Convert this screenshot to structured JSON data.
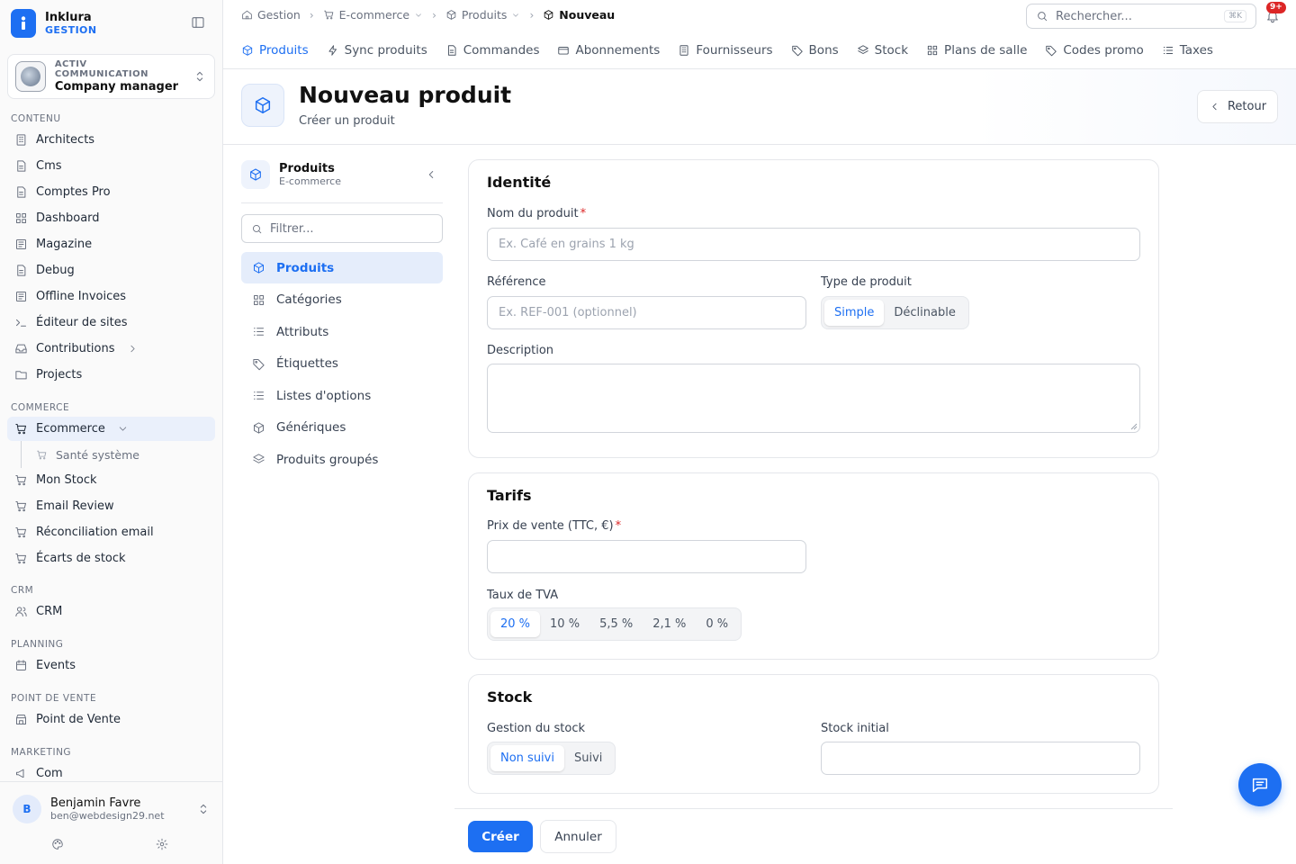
{
  "brand": {
    "name": "Inklura",
    "sub": "GESTION"
  },
  "company": {
    "top": "ACTIV COMMUNICATION",
    "name": "Company manager"
  },
  "sidebar": {
    "sections": [
      {
        "title": "CONTENU",
        "items": [
          "Architects",
          "Cms",
          "Comptes Pro",
          "Dashboard",
          "Magazine",
          "Debug",
          "Offline Invoices",
          "Éditeur de sites",
          "Contributions",
          "Projects"
        ]
      },
      {
        "title": "COMMERCE",
        "items": [
          "Ecommerce",
          "Santé système",
          "Mon Stock",
          "Email Review",
          "Réconciliation email",
          "Écarts de stock"
        ]
      },
      {
        "title": "CRM",
        "items": [
          "CRM"
        ]
      },
      {
        "title": "PLANNING",
        "items": [
          "Events"
        ]
      },
      {
        "title": "POINT DE VENTE",
        "items": [
          "Point de Vente"
        ]
      },
      {
        "title": "MARKETING",
        "items": [
          "Com"
        ]
      }
    ]
  },
  "user": {
    "initial": "B",
    "name": "Benjamin Favre",
    "email": "ben@webdesign29.net"
  },
  "breadcrumb": [
    "Gestion",
    "E-commerce",
    "Produits",
    "Nouveau"
  ],
  "search": {
    "placeholder": "Rechercher...",
    "shortcut": "⌘K"
  },
  "notifications": {
    "badge": "9+"
  },
  "tabs": [
    "Produits",
    "Sync produits",
    "Commandes",
    "Abonnements",
    "Fournisseurs",
    "Bons",
    "Stock",
    "Plans de salle",
    "Codes promo",
    "Taxes"
  ],
  "header": {
    "title": "Nouveau produit",
    "subtitle": "Créer un produit",
    "back": "Retour"
  },
  "subnav": {
    "title": "Produits",
    "subtitle": "E-commerce",
    "filter_placeholder": "Filtrer...",
    "items": [
      "Produits",
      "Catégories",
      "Attributs",
      "Étiquettes",
      "Listes d'options",
      "Génériques",
      "Produits groupés"
    ]
  },
  "identity": {
    "title": "Identité",
    "name_label": "Nom du produit",
    "name_placeholder": "Ex. Café en grains 1 kg",
    "ref_label": "Référence",
    "ref_placeholder": "Ex. REF-001 (optionnel)",
    "type_label": "Type de produit",
    "type_options": [
      "Simple",
      "Déclinable"
    ],
    "type_selected": "Simple",
    "desc_label": "Description"
  },
  "pricing": {
    "title": "Tarifs",
    "price_label": "Prix de vente (TTC, €)",
    "vat_label": "Taux de TVA",
    "vat_options": [
      "20 %",
      "10 %",
      "5,5 %",
      "2,1 %",
      "0 %"
    ],
    "vat_selected": "20 %"
  },
  "stock": {
    "title": "Stock",
    "mgmt_label": "Gestion du stock",
    "mgmt_options": [
      "Non suivi",
      "Suivi"
    ],
    "mgmt_selected": "Non suivi",
    "initial_label": "Stock initial"
  },
  "actions": {
    "create": "Créer",
    "cancel": "Annuler"
  },
  "colors": {
    "accent": "#1d6ff2",
    "danger": "#dc2626"
  }
}
